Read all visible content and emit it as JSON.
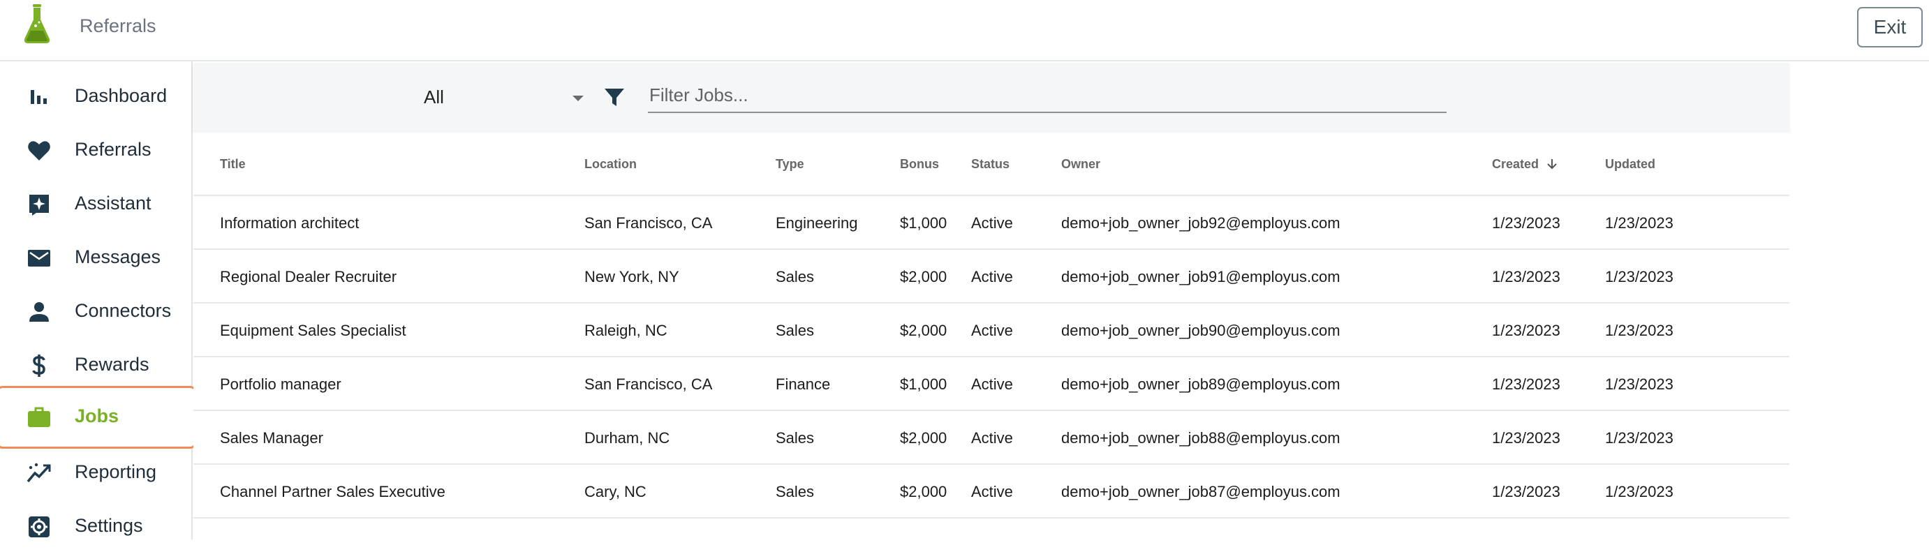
{
  "header": {
    "title": "Referrals",
    "exit_label": "Exit",
    "brand_color": "#7ab125"
  },
  "sidebar": {
    "items": [
      {
        "label": "Dashboard",
        "icon": "bar-chart-icon"
      },
      {
        "label": "Referrals",
        "icon": "heart-icon"
      },
      {
        "label": "Assistant",
        "icon": "sparkle-icon"
      },
      {
        "label": "Messages",
        "icon": "mail-icon"
      },
      {
        "label": "Connectors",
        "icon": "person-icon"
      },
      {
        "label": "Rewards",
        "icon": "dollar-icon"
      },
      {
        "label": "Jobs",
        "icon": "briefcase-icon",
        "active": true
      },
      {
        "label": "Reporting",
        "icon": "trend-icon"
      },
      {
        "label": "Settings",
        "icon": "gear-icon"
      }
    ],
    "active_color": "#7ab125",
    "highlight_color": "#ee8a5b"
  },
  "filters": {
    "select_value": "All",
    "search_placeholder": "Filter Jobs...",
    "search_value": ""
  },
  "table": {
    "columns": {
      "title": "Title",
      "location": "Location",
      "type": "Type",
      "bonus": "Bonus",
      "status": "Status",
      "owner": "Owner",
      "created": "Created",
      "updated": "Updated"
    },
    "sort_column": "created",
    "sort_direction": "descending",
    "rows": [
      {
        "title": "Information architect",
        "location": "San Francisco, CA",
        "type": "Engineering",
        "bonus": "$1,000",
        "status": "Active",
        "owner": "demo+job_owner_job92@employus.com",
        "created": "1/23/2023",
        "updated": "1/23/2023"
      },
      {
        "title": "Regional Dealer Recruiter",
        "location": "New York, NY",
        "type": "Sales",
        "bonus": "$2,000",
        "status": "Active",
        "owner": "demo+job_owner_job91@employus.com",
        "created": "1/23/2023",
        "updated": "1/23/2023"
      },
      {
        "title": "Equipment Sales Specialist",
        "location": "Raleigh, NC",
        "type": "Sales",
        "bonus": "$2,000",
        "status": "Active",
        "owner": "demo+job_owner_job90@employus.com",
        "created": "1/23/2023",
        "updated": "1/23/2023"
      },
      {
        "title": "Portfolio manager",
        "location": "San Francisco, CA",
        "type": "Finance",
        "bonus": "$1,000",
        "status": "Active",
        "owner": "demo+job_owner_job89@employus.com",
        "created": "1/23/2023",
        "updated": "1/23/2023"
      },
      {
        "title": "Sales Manager",
        "location": "Durham, NC",
        "type": "Sales",
        "bonus": "$2,000",
        "status": "Active",
        "owner": "demo+job_owner_job88@employus.com",
        "created": "1/23/2023",
        "updated": "1/23/2023"
      },
      {
        "title": "Channel Partner Sales Executive",
        "location": "Cary, NC",
        "type": "Sales",
        "bonus": "$2,000",
        "status": "Active",
        "owner": "demo+job_owner_job87@employus.com",
        "created": "1/23/2023",
        "updated": "1/23/2023"
      }
    ]
  }
}
